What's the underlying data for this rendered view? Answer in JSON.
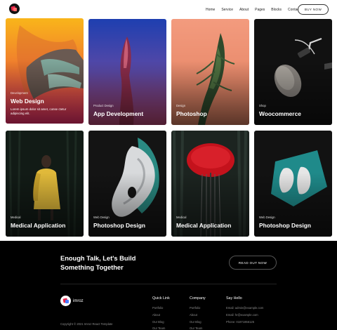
{
  "nav": {
    "items": [
      "Home",
      "Service",
      "About",
      "Pages",
      "Blocks",
      "Contact"
    ],
    "buy_label": "BUY NOW"
  },
  "cards": [
    {
      "category": "Development",
      "title": "Web Design",
      "description": "Lorem ipsum dolor sit amet, conse ctetur adipiscing elit."
    },
    {
      "category": "Product Design",
      "title": "App Development"
    },
    {
      "category": "Design",
      "title": "Photoshop"
    },
    {
      "category": "Shop",
      "title": "Woocommerce"
    },
    {
      "category": "Medical",
      "title": "Medical Application"
    },
    {
      "category": "Web Design",
      "title": "Photoshop Design"
    },
    {
      "category": "Medical",
      "title": "Medical Application"
    },
    {
      "category": "Web Design",
      "title": "Photoshop Design"
    }
  ],
  "footer": {
    "cta_line1": "Enough Talk, Let's Build",
    "cta_line2": "Something Together",
    "cta_button": "READ OUT NOW",
    "brand": "imroz",
    "copyright": "Copyright © 2021 Imroz React Template",
    "columns": [
      {
        "heading": "Quick Link",
        "links": [
          "Portfolio",
          "About",
          "Our Blog",
          "Our Team"
        ]
      },
      {
        "heading": "Company",
        "links": [
          "Portfolio",
          "About",
          "Our Blog",
          "Our Team"
        ]
      },
      {
        "heading": "Say Hello",
        "links": [
          "Email: admin@example.com",
          "Email: hr@example.com",
          "Phone: 01871856125"
        ]
      }
    ]
  },
  "colors": {
    "footer_bg": "#000000",
    "brand_red": "#e8264a"
  }
}
